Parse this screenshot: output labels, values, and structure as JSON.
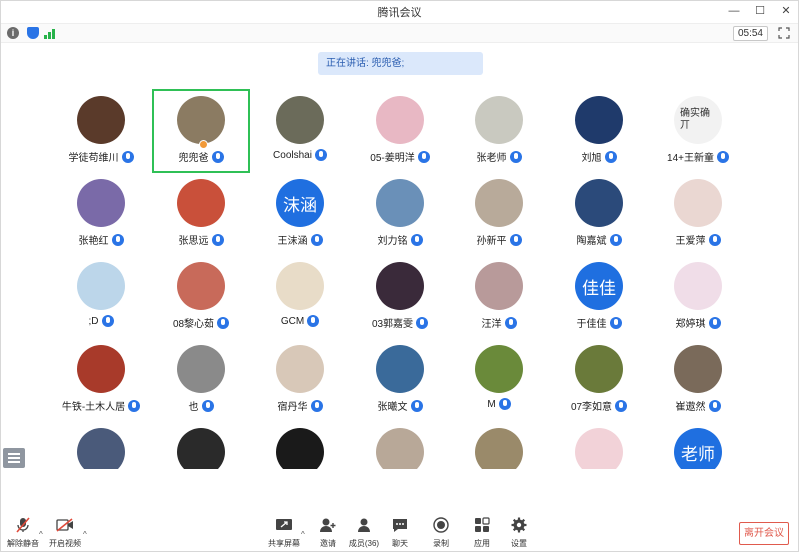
{
  "window": {
    "title": "腾讯会议",
    "controls": [
      "—",
      "☐",
      "✕"
    ]
  },
  "status": {
    "timer": "05:54"
  },
  "speaking_banner": "正在讲话: 兜兜爸;",
  "participants": [
    {
      "name": "学徒苟维川",
      "avatar_color": "#5a3a2a",
      "avatar_text": ""
    },
    {
      "name": "兜兜爸",
      "avatar_color": "#8b7b62",
      "avatar_text": "",
      "active": true
    },
    {
      "name": "Coolshai",
      "avatar_color": "#6b6b5a",
      "avatar_text": ""
    },
    {
      "name": "05-姜明洋",
      "avatar_color": "#e8b8c4",
      "avatar_text": ""
    },
    {
      "name": "张老师",
      "avatar_color": "#c9c9c0",
      "avatar_text": ""
    },
    {
      "name": "刘旭",
      "avatar_color": "#1f3a6b",
      "avatar_text": ""
    },
    {
      "name": "14+王新童",
      "avatar_color": "#f2f2f2",
      "avatar_text": "确实确丌"
    },
    {
      "name": "张艳红",
      "avatar_color": "#7a6aa8",
      "avatar_text": ""
    },
    {
      "name": "张思远",
      "avatar_color": "#c9503a",
      "avatar_text": ""
    },
    {
      "name": "王沫涵",
      "avatar_color": "#1f6fe0",
      "avatar_text": "沫涵"
    },
    {
      "name": "刘力铭",
      "avatar_color": "#6a90b8",
      "avatar_text": ""
    },
    {
      "name": "孙新平",
      "avatar_color": "#b8aa9a",
      "avatar_text": ""
    },
    {
      "name": "陶嘉斌",
      "avatar_color": "#2b4a7a",
      "avatar_text": ""
    },
    {
      "name": "王爱萍",
      "avatar_color": "#ead7d2",
      "avatar_text": ""
    },
    {
      "name": ";D",
      "avatar_color": "#bcd6ea",
      "avatar_text": ""
    },
    {
      "name": "08黎心茹",
      "avatar_color": "#c86a5a",
      "avatar_text": ""
    },
    {
      "name": "GCM",
      "avatar_color": "#e8dcc8",
      "avatar_text": ""
    },
    {
      "name": "03郭嘉雯",
      "avatar_color": "#3a2a3a",
      "avatar_text": ""
    },
    {
      "name": "汪洋",
      "avatar_color": "#b89a9a",
      "avatar_text": ""
    },
    {
      "name": "于佳佳",
      "avatar_color": "#1f6fe0",
      "avatar_text": "佳佳"
    },
    {
      "name": "郑婷琪",
      "avatar_color": "#f0dde8",
      "avatar_text": ""
    },
    {
      "name": "牛铁-土木人居",
      "avatar_color": "#a83a2a",
      "avatar_text": ""
    },
    {
      "name": "也",
      "avatar_color": "#8a8a8a",
      "avatar_text": ""
    },
    {
      "name": "宿丹华",
      "avatar_color": "#d8c8b8",
      "avatar_text": ""
    },
    {
      "name": "张曦文",
      "avatar_color": "#3a6a9a",
      "avatar_text": ""
    },
    {
      "name": "M",
      "avatar_color": "#6a8a3a",
      "avatar_text": ""
    },
    {
      "name": "07李如意",
      "avatar_color": "#6a7a3a",
      "avatar_text": ""
    },
    {
      "name": "崔遨然",
      "avatar_color": "#7a6a5a",
      "avatar_text": ""
    },
    {
      "name": "",
      "avatar_color": "#4a5a7a",
      "avatar_text": ""
    },
    {
      "name": "",
      "avatar_color": "#2a2a2a",
      "avatar_text": ""
    },
    {
      "name": "",
      "avatar_color": "#1a1a1a",
      "avatar_text": ""
    },
    {
      "name": "",
      "avatar_color": "#b8a898",
      "avatar_text": ""
    },
    {
      "name": "",
      "avatar_color": "#9a8a6a",
      "avatar_text": ""
    },
    {
      "name": "",
      "avatar_color": "#f2d2d8",
      "avatar_text": ""
    },
    {
      "name": "",
      "avatar_color": "#1f6fe0",
      "avatar_text": "老师"
    }
  ],
  "toolbar": {
    "unmute": "解除静音",
    "start_video": "开启视频",
    "share_screen": "共享屏幕",
    "invite": "邀请",
    "members": "成员(36)",
    "chat": "聊天",
    "record": "录制",
    "apps": "应用",
    "settings": "设置",
    "leave": "离开会议"
  },
  "colors": {
    "accent": "#2a74e6",
    "active_border": "#2fc056",
    "leave": "#e05a4d"
  }
}
